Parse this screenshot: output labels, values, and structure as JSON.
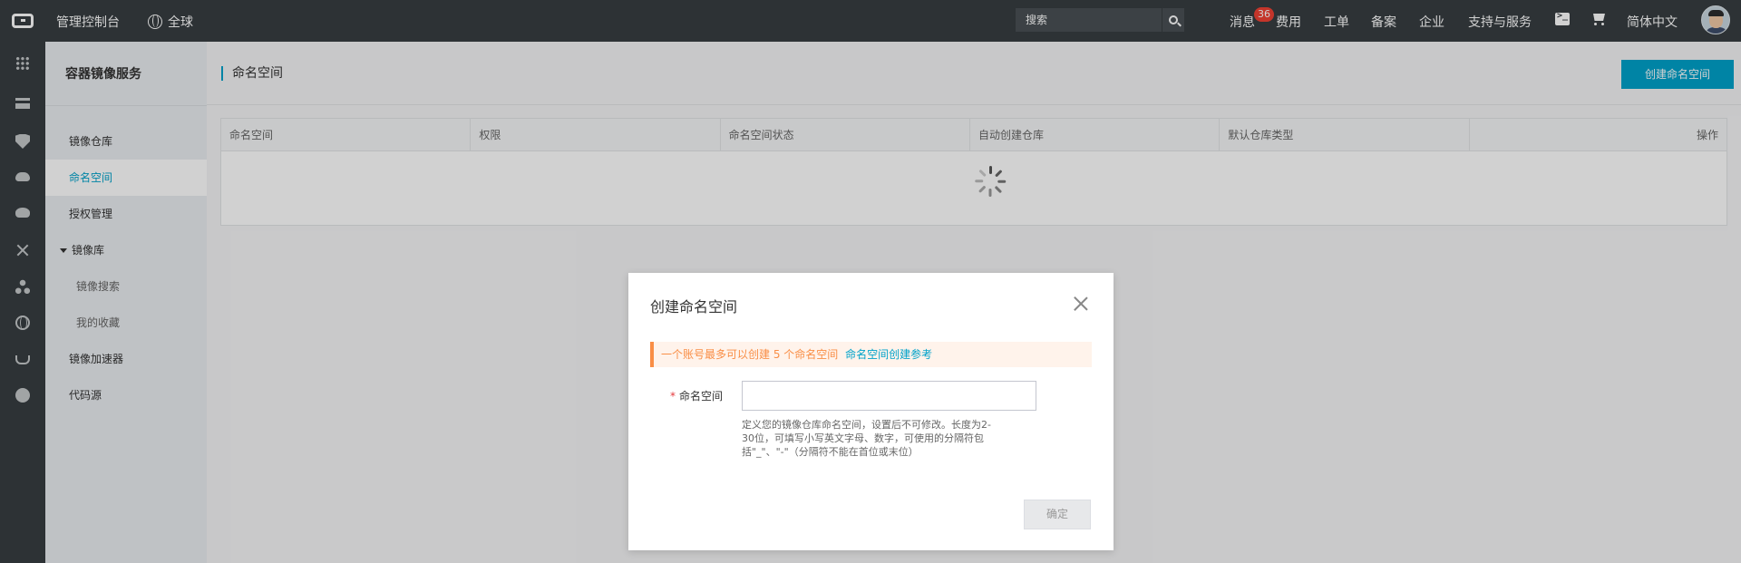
{
  "topbar": {
    "console_label": "管理控制台",
    "region_label": "全球",
    "search_placeholder": "搜索",
    "messages_label": "消息",
    "messages_badge": "36",
    "nav_items": [
      "费用",
      "工单",
      "备案",
      "企业",
      "支持与服务"
    ],
    "language_label": "简体中文"
  },
  "rail": {
    "icons": [
      "apps-grid-icon",
      "server-icon",
      "shield-icon",
      "cloud-icon",
      "cloud-upload-icon",
      "network-icon",
      "cluster-icon",
      "globe-icon",
      "cup-icon",
      "circle-icon"
    ]
  },
  "sidebar": {
    "title": "容器镜像服务",
    "items": [
      {
        "label": "镜像仓库"
      },
      {
        "label": "命名空间",
        "active": true
      },
      {
        "label": "授权管理"
      },
      {
        "label": "镜像库",
        "group": true
      },
      {
        "label": "镜像搜索",
        "sub": true
      },
      {
        "label": "我的收藏",
        "sub": true
      },
      {
        "label": "镜像加速器"
      },
      {
        "label": "代码源"
      }
    ]
  },
  "main": {
    "page_title": "命名空间",
    "create_button": "创建命名空间",
    "table_headers": [
      "命名空间",
      "权限",
      "命名空间状态",
      "自动创建仓库",
      "默认仓库类型",
      "操作"
    ]
  },
  "dialog": {
    "title": "创建命名空间",
    "notice_text": "一个账号最多可以创建 5 个命名空间",
    "notice_link": "命名空间创建参考",
    "field_label": "命名空间",
    "field_value": "",
    "help_text": "定义您的镜像仓库命名空间，设置后不可修改。长度为2-30位，可填写小写英文字母、数字，可使用的分隔符包括\"_\"、\"-\"（分隔符不能在首位或末位）",
    "confirm_button": "确定"
  },
  "colors": {
    "topbar_bg": "#373d41",
    "accent": "#00a2ca",
    "notice_orange": "#f98e46",
    "badge_red": "#f04134"
  }
}
